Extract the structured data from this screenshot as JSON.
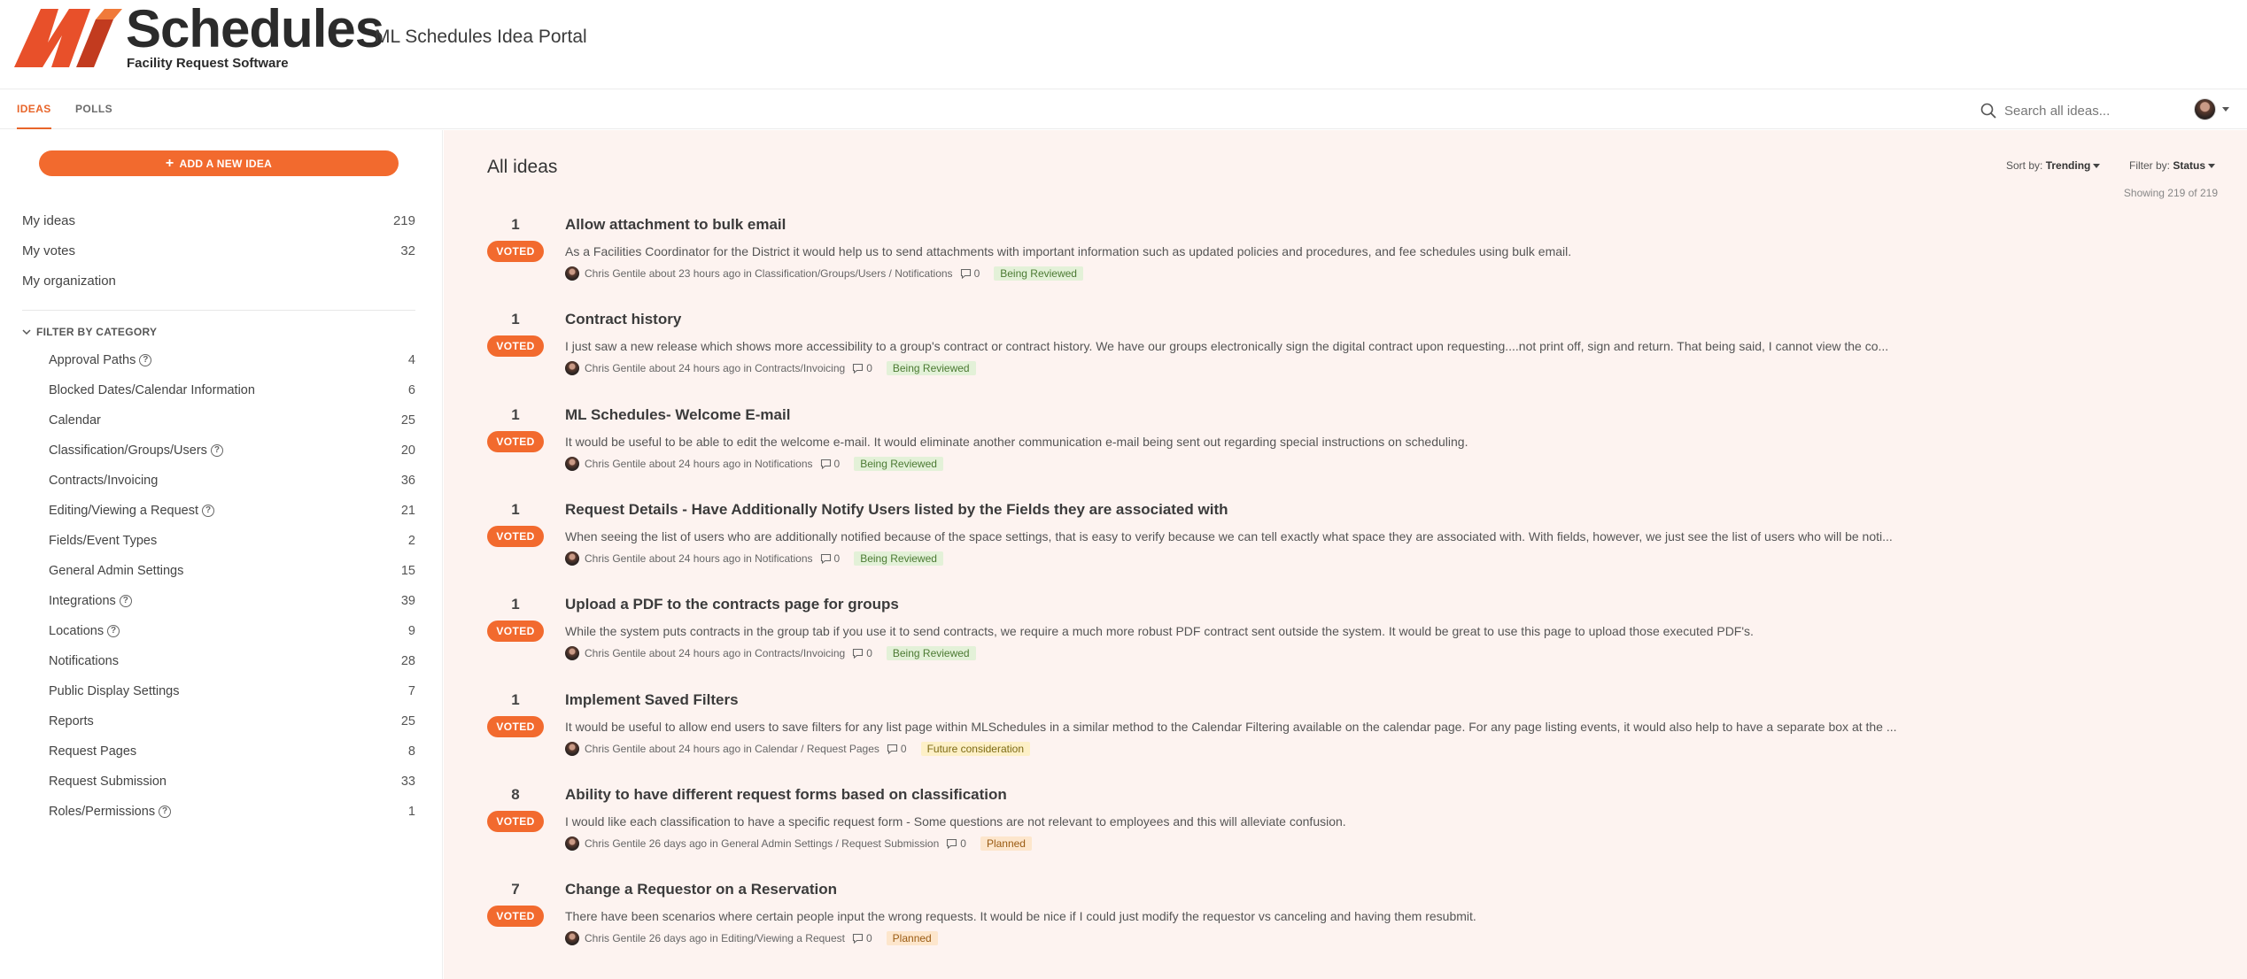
{
  "header": {
    "logo_letter": "M",
    "logo_title": "Schedules",
    "logo_subtitle": "Facility Request Software",
    "portal_title": "ML Schedules Idea Portal",
    "brand_color": "#f26a2e"
  },
  "nav": {
    "tabs": [
      {
        "label": "IDEAS",
        "active": true
      },
      {
        "label": "POLLS",
        "active": false
      }
    ],
    "search_placeholder": "Search all ideas..."
  },
  "sidebar": {
    "add_button_label": "ADD A NEW IDEA",
    "my_items": [
      {
        "label": "My ideas",
        "count": "219"
      },
      {
        "label": "My votes",
        "count": "32"
      },
      {
        "label": "My organization",
        "count": ""
      }
    ],
    "filter_header": "FILTER BY CATEGORY",
    "categories": [
      {
        "label": "Approval Paths",
        "count": "4",
        "help": true
      },
      {
        "label": "Blocked Dates/Calendar Information",
        "count": "6",
        "help": false
      },
      {
        "label": "Calendar",
        "count": "25",
        "help": false
      },
      {
        "label": "Classification/Groups/Users",
        "count": "20",
        "help": true
      },
      {
        "label": "Contracts/Invoicing",
        "count": "36",
        "help": false
      },
      {
        "label": "Editing/Viewing a Request",
        "count": "21",
        "help": true
      },
      {
        "label": "Fields/Event Types",
        "count": "2",
        "help": false
      },
      {
        "label": "General Admin Settings",
        "count": "15",
        "help": false
      },
      {
        "label": "Integrations",
        "count": "39",
        "help": true
      },
      {
        "label": "Locations",
        "count": "9",
        "help": true
      },
      {
        "label": "Notifications",
        "count": "28",
        "help": false
      },
      {
        "label": "Public Display Settings",
        "count": "7",
        "help": false
      },
      {
        "label": "Reports",
        "count": "25",
        "help": false
      },
      {
        "label": "Request Pages",
        "count": "8",
        "help": false
      },
      {
        "label": "Request Submission",
        "count": "33",
        "help": false
      },
      {
        "label": "Roles/Permissions",
        "count": "1",
        "help": true
      }
    ]
  },
  "main": {
    "title": "All ideas",
    "sort_label": "Sort by:",
    "sort_value": "Trending",
    "filter_label": "Filter by:",
    "filter_value": "Status",
    "showing": "Showing 219 of 219",
    "vote_label": "VOTED",
    "ideas": [
      {
        "votes": "1",
        "title": "Allow attachment to bulk email",
        "desc": "As a Facilities Coordinator for the District it would help us to send attachments with important information such as updated policies and procedures, and fee schedules using bulk email.",
        "author": "Chris Gentile",
        "time": "about 23 hours ago",
        "category": "Classification/Groups/Users / Notifications",
        "comments": "0",
        "status": "Being Reviewed",
        "status_type": "reviewed"
      },
      {
        "votes": "1",
        "title": "Contract history",
        "desc": "I just saw a new release which shows more accessibility to a group's contract or contract history. We have our groups electronically sign the digital contract upon requesting....not print off, sign and return. That being said, I cannot view the co...",
        "author": "Chris Gentile",
        "time": "about 24 hours ago",
        "category": "Contracts/Invoicing",
        "comments": "0",
        "status": "Being Reviewed",
        "status_type": "reviewed"
      },
      {
        "votes": "1",
        "title": "ML Schedules- Welcome E-mail",
        "desc": "It would be useful to be able to edit the welcome e-mail. It would eliminate another communication e-mail being sent out regarding special instructions on scheduling.",
        "author": "Chris Gentile",
        "time": "about 24 hours ago",
        "category": "Notifications",
        "comments": "0",
        "status": "Being Reviewed",
        "status_type": "reviewed"
      },
      {
        "votes": "1",
        "title": "Request Details - Have Additionally Notify Users listed by the Fields they are associated with",
        "desc": "When seeing the list of users who are additionally notified because of the space settings, that is easy to verify because we can tell exactly what space they are associated with. With fields, however, we just see the list of users who will be noti...",
        "author": "Chris Gentile",
        "time": "about 24 hours ago",
        "category": "Notifications",
        "comments": "0",
        "status": "Being Reviewed",
        "status_type": "reviewed"
      },
      {
        "votes": "1",
        "title": "Upload a PDF to the contracts page for groups",
        "desc": "While the system puts contracts in the group tab if you use it to send contracts, we require a much more robust PDF contract sent outside the system. It would be great to use this page to upload those executed PDF's.",
        "author": "Chris Gentile",
        "time": "about 24 hours ago",
        "category": "Contracts/Invoicing",
        "comments": "0",
        "status": "Being Reviewed",
        "status_type": "reviewed"
      },
      {
        "votes": "1",
        "title": "Implement Saved Filters",
        "desc": "It would be useful to allow end users to save filters for any list page within MLSchedules in a similar method to the Calendar Filtering available on the calendar page. For any page listing events, it would also help to have a separate box at the ...",
        "author": "Chris Gentile",
        "time": "about 24 hours ago",
        "category": "Calendar / Request Pages",
        "comments": "0",
        "status": "Future consideration",
        "status_type": "future"
      },
      {
        "votes": "8",
        "title": "Ability to have different request forms based on classification",
        "desc": "I would like each classification to have a specific request form - Some questions are not relevant to employees and this will alleviate confusion.",
        "author": "Chris Gentile",
        "time": "26 days ago",
        "category": "General Admin Settings / Request Submission",
        "comments": "0",
        "status": "Planned",
        "status_type": "planned"
      },
      {
        "votes": "7",
        "title": "Change a Requestor on a Reservation",
        "desc": "There have been scenarios where certain people input the wrong requests. It would be nice if I could just modify the requestor vs canceling and having them resubmit.",
        "author": "Chris Gentile",
        "time": "26 days ago",
        "category": "Editing/Viewing a Request",
        "comments": "0",
        "status": "Planned",
        "status_type": "planned"
      }
    ]
  }
}
